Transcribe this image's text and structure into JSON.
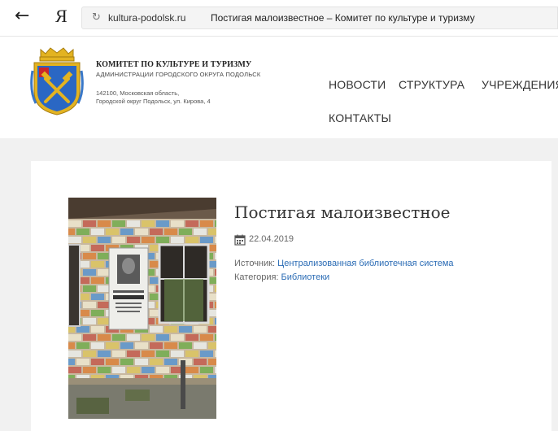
{
  "browser": {
    "back_glyph": "←",
    "ya_logo": "Я",
    "reload_glyph": "↻",
    "url_domain": "kultura-podolsk.ru",
    "page_title": "Постигая малоизвестное – Комитет по культуре и туризму"
  },
  "header": {
    "org_name": "КОМИТЕТ ПО КУЛЬТУРЕ И ТУРИЗМУ",
    "org_sub": "АДМИНИСТРАЦИИ ГОРОДСКОГО ОКРУГА ПОДОЛЬСК",
    "address_line1": "142100, Московская область,",
    "address_line2": "Городской округ Подольск, ул. Кирова, 4",
    "logo_icon": "coat-of-arms-icon"
  },
  "nav": {
    "news": "НОВОСТИ",
    "structure": "СТРУКТУРА",
    "institutions": "УЧРЕЖДЕНИЯ",
    "contacts": "КОНТАКТЫ"
  },
  "article": {
    "title": "Постигая малоизвестное",
    "date": "22.04.2019",
    "source_label": "Источник: ",
    "source_value": "Централизованная библиотечная система",
    "category_label": "Категория: ",
    "category_value": "Библиотеки",
    "photo_icon": "memorial-plaque-photo"
  },
  "colors": {
    "link": "#2b6cb5",
    "background": "#f1f1f1",
    "shield_blue": "#2a67c4",
    "shield_gold": "#e3b321"
  }
}
